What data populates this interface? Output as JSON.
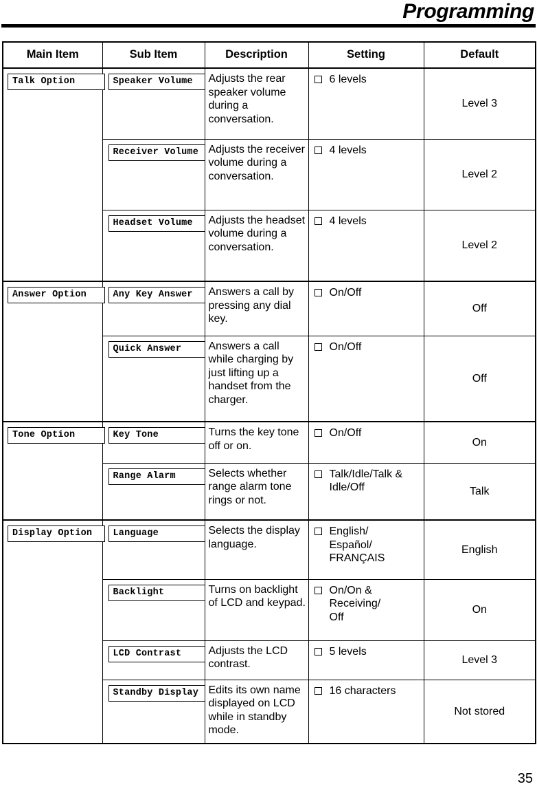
{
  "header": {
    "title": "Programming"
  },
  "table": {
    "columns": [
      "Main Item",
      "Sub Item",
      "Description",
      "Setting",
      "Default"
    ],
    "sections": [
      {
        "main_item": "Talk Option",
        "rows": [
          {
            "sub_item": "Speaker Volume",
            "description": "Adjusts the rear speaker volume during a conversation.",
            "setting": [
              "6 levels"
            ],
            "default": "Level 3"
          },
          {
            "sub_item": "Receiver Volume",
            "description": "Adjusts the receiver volume during a conversation.",
            "setting": [
              "4 levels"
            ],
            "default": "Level 2"
          },
          {
            "sub_item": "Headset Volume",
            "description": "Adjusts the headset volume during a conversation.",
            "setting": [
              "4 levels"
            ],
            "default": "Level 2"
          }
        ]
      },
      {
        "main_item": "Answer Option",
        "rows": [
          {
            "sub_item": "Any Key Answer",
            "description": "Answers a call by pressing any dial key.",
            "setting": [
              "On/Off"
            ],
            "default": "Off"
          },
          {
            "sub_item": "Quick Answer",
            "description": "Answers a call while charging by just lifting up a handset from the charger.",
            "setting": [
              "On/Off"
            ],
            "default": "Off"
          }
        ]
      },
      {
        "main_item": "Tone Option",
        "rows": [
          {
            "sub_item": "Key Tone",
            "description": "Turns the key tone off or on.",
            "setting": [
              "On/Off"
            ],
            "default": "On"
          },
          {
            "sub_item": "Range Alarm",
            "description": "Selects whether range alarm tone rings or not.",
            "setting": [
              "Talk/Idle/Talk & Idle/Off"
            ],
            "default": "Talk"
          }
        ]
      },
      {
        "main_item": "Display Option",
        "rows": [
          {
            "sub_item": "Language",
            "description": "Selects the display language.",
            "setting": [
              "English/",
              "Español/",
              "FRANÇAIS"
            ],
            "default": "English"
          },
          {
            "sub_item": "Backlight",
            "description": "Turns on backlight of LCD and keypad.",
            "setting": [
              "On/On &",
              "Receiving/",
              "Off"
            ],
            "default": "On"
          },
          {
            "sub_item": "LCD Contrast",
            "description": "Adjusts the LCD contrast.",
            "setting": [
              "5 levels"
            ],
            "default": "Level 3"
          },
          {
            "sub_item": "Standby Display",
            "description": "Edits its own name displayed on LCD while in standby mode.",
            "setting": [
              "16 characters"
            ],
            "default": "Not stored"
          }
        ]
      }
    ]
  },
  "footer": {
    "page_number": "35"
  }
}
